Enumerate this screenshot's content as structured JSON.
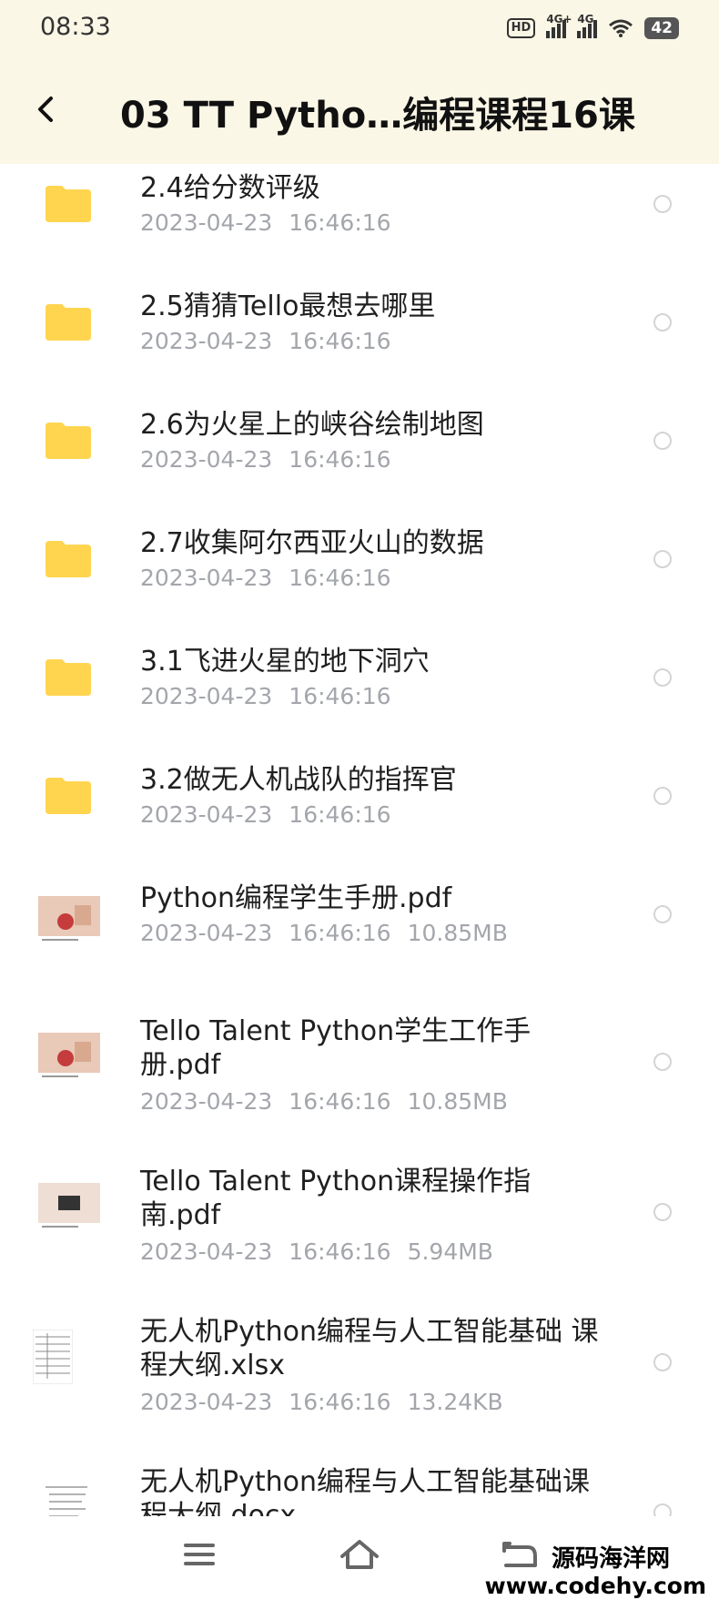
{
  "status_bar": {
    "time": "08:33",
    "hd_label": "HD",
    "signal1_label": "4G+",
    "signal2_label": "4G",
    "battery": "42"
  },
  "header": {
    "title": "03 TT Pytho…编程课程16课"
  },
  "items": [
    {
      "type": "folder",
      "name": "2.4给分数评级",
      "date": "2023-04-23",
      "time": "16:46:16",
      "size": ""
    },
    {
      "type": "folder",
      "name": "2.5猜猜Tello最想去哪里",
      "date": "2023-04-23",
      "time": "16:46:16",
      "size": ""
    },
    {
      "type": "folder",
      "name": "2.6为火星上的峡谷绘制地图",
      "date": "2023-04-23",
      "time": "16:46:16",
      "size": ""
    },
    {
      "type": "folder",
      "name": "2.7收集阿尔西亚火山的数据",
      "date": "2023-04-23",
      "time": "16:46:16",
      "size": ""
    },
    {
      "type": "folder",
      "name": "3.1飞进火星的地下洞穴",
      "date": "2023-04-23",
      "time": "16:46:16",
      "size": ""
    },
    {
      "type": "folder",
      "name": "3.2做无人机战队的指挥官",
      "date": "2023-04-23",
      "time": "16:46:16",
      "size": ""
    },
    {
      "type": "pdf",
      "name": "Python编程学生手册.pdf",
      "date": "2023-04-23",
      "time": "16:46:16",
      "size": "10.85MB"
    },
    {
      "type": "pdf",
      "name": "Tello Talent Python学生工作手册.pdf",
      "date": "2023-04-23",
      "time": "16:46:16",
      "size": "10.85MB"
    },
    {
      "type": "pdf",
      "name": "Tello Talent Python课程操作指南.pdf",
      "date": "2023-04-23",
      "time": "16:46:16",
      "size": "5.94MB"
    },
    {
      "type": "xlsx",
      "name": "无人机Python编程与人工智能基础 课程大纲.xlsx",
      "date": "2023-04-23",
      "time": "16:46:16",
      "size": "13.24KB"
    },
    {
      "type": "docx",
      "name": "无人机Python编程与人工智能基础课程大纲.docx",
      "date": "",
      "time": "",
      "size": ""
    }
  ],
  "watermark": {
    "name": "源码海洋网",
    "url": "www.codehy.com"
  },
  "colors": {
    "header_bg": "#fbf7e6",
    "folder": "#ffd54f",
    "meta_text": "#a3a6ab"
  }
}
